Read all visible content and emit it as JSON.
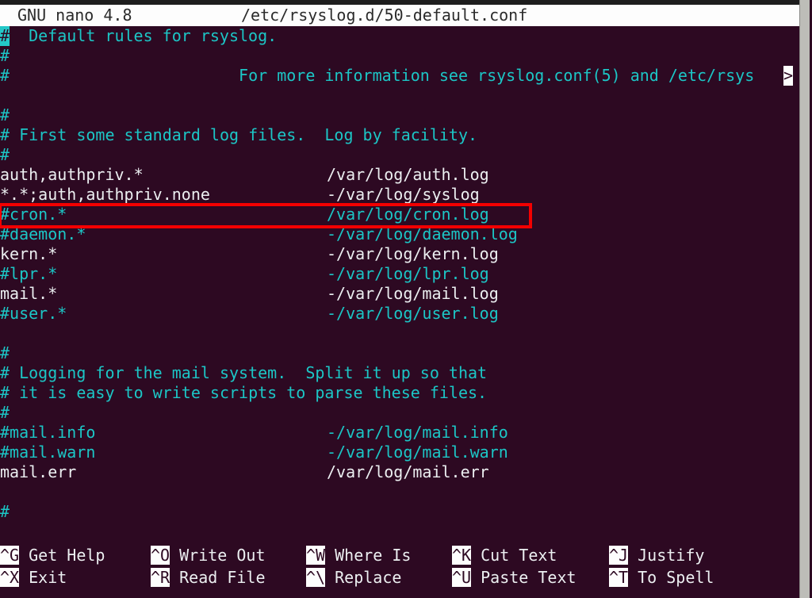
{
  "editor": {
    "name": "GNU nano",
    "version_line": "GNU nano 4.8",
    "filename": "/etc/rsyslog.d/50-default.conf"
  },
  "document": {
    "lines": [
      {
        "left": "#  Default rules for rsyslog.",
        "right": "",
        "kind": "comment",
        "cursor": true
      },
      {
        "left": "#",
        "right": "",
        "kind": "comment"
      },
      {
        "left": "#                        For more information see rsyslog.conf(5) and /etc/rsys",
        "right": "",
        "kind": "comment",
        "continued": true
      },
      {
        "left": "",
        "right": "",
        "kind": "blank"
      },
      {
        "left": "#",
        "right": "",
        "kind": "comment"
      },
      {
        "left": "# First some standard log files.  Log by facility.",
        "right": "",
        "kind": "comment"
      },
      {
        "left": "#",
        "right": "",
        "kind": "comment"
      },
      {
        "left": "auth,authpriv.*",
        "right": "/var/log/auth.log",
        "kind": "plain"
      },
      {
        "left": "*.*;auth,authpriv.none",
        "right": "-/var/log/syslog",
        "kind": "plain"
      },
      {
        "left": "#cron.*",
        "right": "/var/log/cron.log",
        "kind": "comment",
        "highlighted": true
      },
      {
        "left": "#daemon.*",
        "right": "-/var/log/daemon.log",
        "kind": "comment"
      },
      {
        "left": "kern.*",
        "right": "-/var/log/kern.log",
        "kind": "plain"
      },
      {
        "left": "#lpr.*",
        "right": "-/var/log/lpr.log",
        "kind": "comment"
      },
      {
        "left": "mail.*",
        "right": "-/var/log/mail.log",
        "kind": "plain"
      },
      {
        "left": "#user.*",
        "right": "-/var/log/user.log",
        "kind": "comment"
      },
      {
        "left": "",
        "right": "",
        "kind": "blank"
      },
      {
        "left": "#",
        "right": "",
        "kind": "comment"
      },
      {
        "left": "# Logging for the mail system.  Split it up so that",
        "right": "",
        "kind": "comment"
      },
      {
        "left": "# it is easy to write scripts to parse these files.",
        "right": "",
        "kind": "comment"
      },
      {
        "left": "#",
        "right": "",
        "kind": "comment"
      },
      {
        "left": "#mail.info",
        "right": "-/var/log/mail.info",
        "kind": "comment"
      },
      {
        "left": "#mail.warn",
        "right": "-/var/log/mail.warn",
        "kind": "comment"
      },
      {
        "left": "mail.err",
        "right": "/var/log/mail.err",
        "kind": "plain"
      },
      {
        "left": "",
        "right": "",
        "kind": "blank"
      },
      {
        "left": "#",
        "right": "",
        "kind": "comment"
      }
    ],
    "continuation_marker": ">"
  },
  "annotation": {
    "shape": "rectangle",
    "color": "#f40000",
    "target_line": "#cron.*                         /var/log/cron.log"
  },
  "shortcuts": {
    "row1": [
      {
        "key": "^G",
        "label": "Get Help"
      },
      {
        "key": "^O",
        "label": "Write Out"
      },
      {
        "key": "^W",
        "label": "Where Is"
      },
      {
        "key": "^K",
        "label": "Cut Text"
      },
      {
        "key": "^J",
        "label": "Justify"
      }
    ],
    "row2": [
      {
        "key": "^X",
        "label": "Exit"
      },
      {
        "key": "^R",
        "label": "Read File"
      },
      {
        "key": "^\\",
        "label": "Replace"
      },
      {
        "key": "^U",
        "label": "Paste Text"
      },
      {
        "key": "^T",
        "label": "To Spell"
      }
    ]
  },
  "colors": {
    "background": "#2d0922",
    "comment": "#1cc6c6",
    "plain": "#eceff1",
    "titlebar_bg": "#fdfdfd",
    "titlebar_fg": "#2b2b2b",
    "cursor": "#24c8c8",
    "annotation": "#f40000"
  }
}
